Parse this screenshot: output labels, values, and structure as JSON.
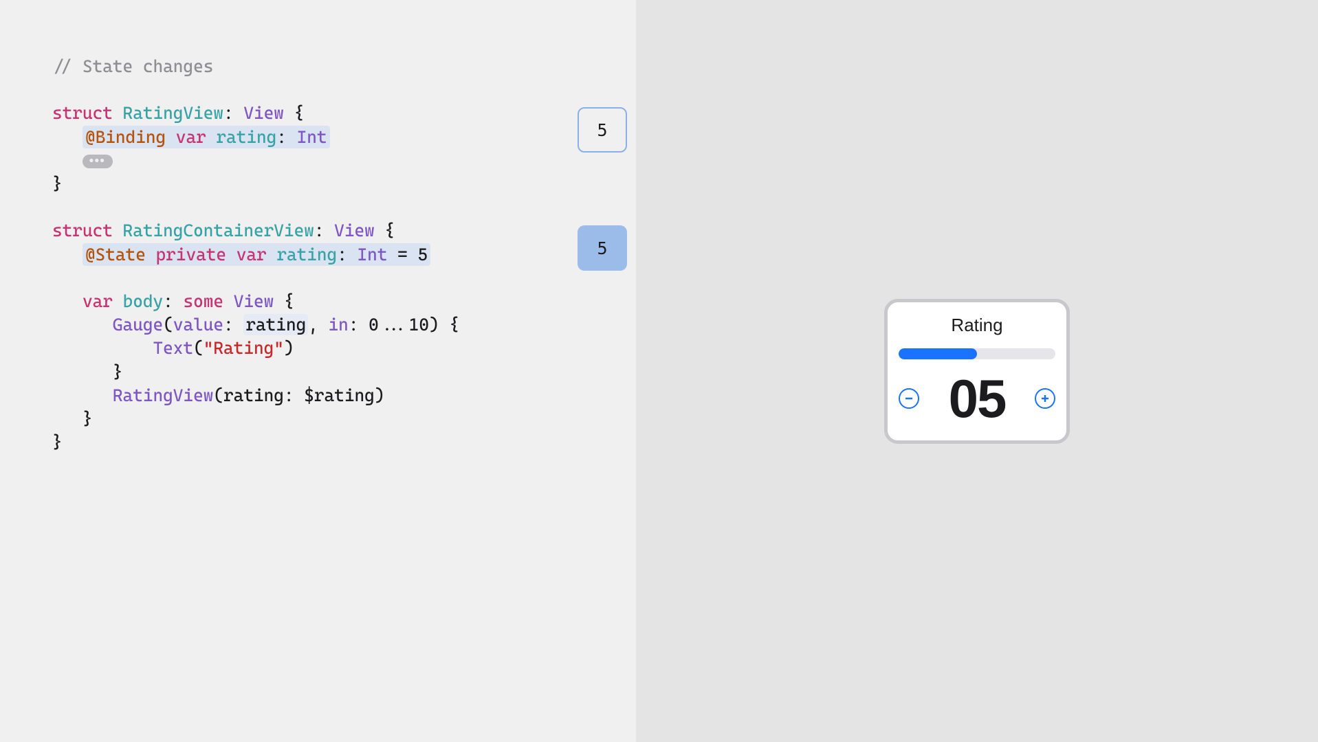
{
  "code": {
    "comment": "// State changes",
    "struct1_keyword": "struct",
    "struct1_name": "RatingView",
    "struct1_protocol": "View",
    "binding_decorator": "@Binding",
    "var_kw": "var",
    "rating_name": "rating",
    "int_type": "Int",
    "fold_label": "●●●",
    "struct2_keyword": "struct",
    "struct2_name": "RatingContainerView",
    "struct2_protocol": "View",
    "state_decorator": "@State",
    "private_kw": "private",
    "state_default": "5",
    "body_name": "body",
    "some_kw": "some",
    "view_type": "View",
    "gauge_name": "Gauge",
    "value_label": "value",
    "in_label": "in",
    "range": "0...10",
    "text_name": "Text",
    "text_literal": "\"Rating\"",
    "ratingview_call": "RatingView",
    "rating_arg": "$rating"
  },
  "valuebox": {
    "binding_val": "5",
    "state_val": "5"
  },
  "preview": {
    "title": "Rating",
    "number": "05"
  }
}
